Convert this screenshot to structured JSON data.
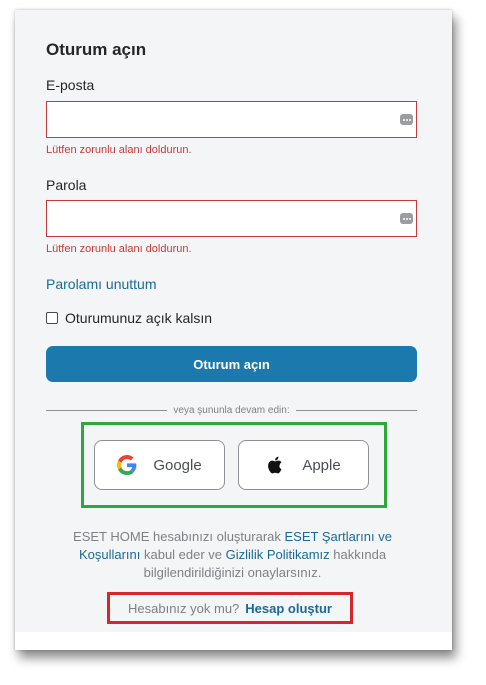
{
  "login": {
    "title": "Oturum açın",
    "email_label": "E-posta",
    "email_value": "",
    "email_error": "Lütfen zorunlu alanı doldurun.",
    "password_label": "Parola",
    "password_value": "",
    "password_error": "Lütfen zorunlu alanı doldurun.",
    "forgot_password": "Parolamı unuttum",
    "remember_me": "Oturumunuz açık kalsın",
    "remember_checked": false,
    "signin_button": "Oturum açın",
    "divider_text": "veya şununla devam edin:",
    "google_button": "Google",
    "apple_button": "Apple",
    "terms_prefix": "ESET HOME hesabınızı oluşturarak ",
    "terms_link": "ESET Şartlarını ve Koşullarını",
    "terms_middle": " kabul eder ve ",
    "privacy_link": "Gizlilik Politikamız",
    "terms_suffix": " hakkında bilgilendirildiğinizi onaylarsınız.",
    "no_account": "Hesabınız yok mu?",
    "create_account": "Hesap oluştur"
  },
  "icons": {
    "field_icon": "password-manager-icon",
    "google_icon": "google-logo-icon",
    "apple_icon": "apple-logo-icon"
  },
  "colors": {
    "primary": "#1b79ad",
    "link": "#1b6a96",
    "error": "#c53a3a",
    "highlight_green": "#2ea838",
    "highlight_red": "#d3272c"
  }
}
